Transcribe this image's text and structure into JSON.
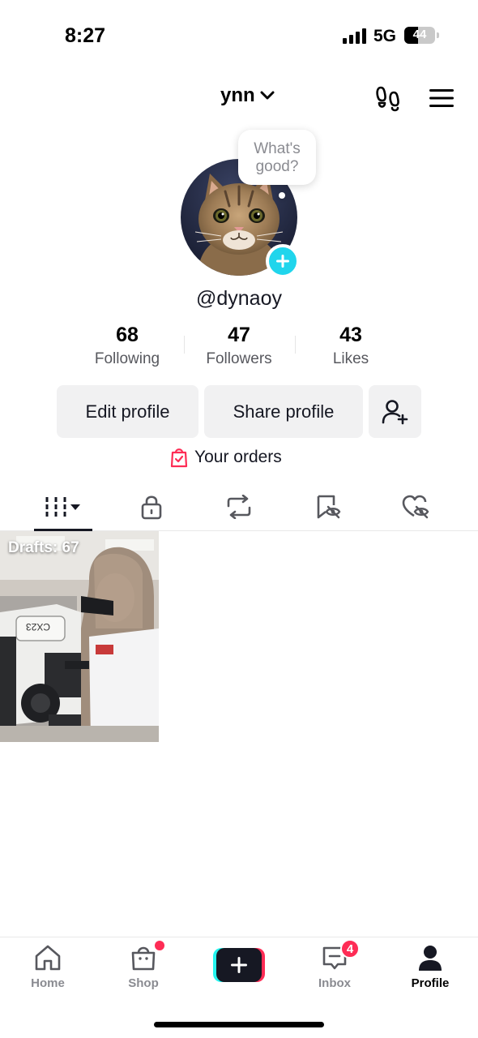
{
  "status_bar": {
    "time": "8:27",
    "network": "5G",
    "battery_level": "44",
    "battery_fraction": 0.44
  },
  "header": {
    "username": "ynn",
    "icons": [
      "footprints-icon",
      "menu-icon"
    ]
  },
  "profile": {
    "bubble_text": "What's good?",
    "handle": "@dynaoy",
    "stats": [
      {
        "value": "68",
        "label": "Following"
      },
      {
        "value": "47",
        "label": "Followers"
      },
      {
        "value": "43",
        "label": "Likes"
      }
    ],
    "buttons": {
      "edit": "Edit profile",
      "share": "Share profile"
    },
    "orders_label": "Your orders"
  },
  "tabs": [
    "videos-grid-icon",
    "lock-icon",
    "repost-icon",
    "favorites-hidden-icon",
    "liked-hidden-icon"
  ],
  "drafts": {
    "label": "Drafts: 67"
  },
  "bottom_nav": {
    "items": [
      {
        "label": "Home",
        "icon": "home-icon"
      },
      {
        "label": "Shop",
        "icon": "shop-icon"
      },
      {
        "label": "",
        "icon": "create-icon"
      },
      {
        "label": "Inbox",
        "icon": "inbox-icon",
        "badge": "4"
      },
      {
        "label": "Profile",
        "icon": "profile-icon"
      }
    ]
  },
  "colors": {
    "accent": "#20d5ec",
    "badge": "#fe2c55",
    "button_bg": "#f1f1f2"
  }
}
